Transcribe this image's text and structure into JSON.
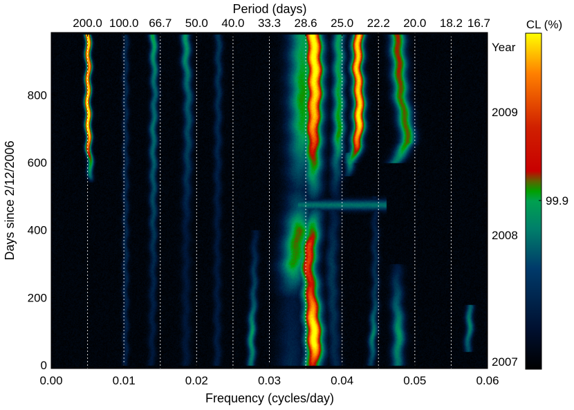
{
  "chart_data": {
    "type": "heatmap",
    "title": "",
    "xlabel": "Frequency (cycles/day)",
    "ylabel": "Days since 2/12/2006",
    "top_axis_label": "Period (days)",
    "right_axis_label": "Year",
    "colorbar_label": "CL (%)",
    "colorbar_tick": "99.9",
    "xlim": [
      0.0,
      0.06
    ],
    "ylim": [
      -10,
      985
    ],
    "x_ticks": [
      {
        "value": 0.0,
        "label": "0.00"
      },
      {
        "value": 0.01,
        "label": "0.01"
      },
      {
        "value": 0.02,
        "label": "0.02"
      },
      {
        "value": 0.03,
        "label": "0.03"
      },
      {
        "value": 0.04,
        "label": "0.04"
      },
      {
        "value": 0.05,
        "label": "0.05"
      },
      {
        "value": 0.06,
        "label": "0.06"
      }
    ],
    "y_ticks": [
      {
        "value": 0,
        "label": "0"
      },
      {
        "value": 200,
        "label": "200"
      },
      {
        "value": 400,
        "label": "400"
      },
      {
        "value": 600,
        "label": "600"
      },
      {
        "value": 800,
        "label": "800"
      }
    ],
    "period_ticks": [
      {
        "freq": 0.005,
        "label": "200.0"
      },
      {
        "freq": 0.01,
        "label": "100.0"
      },
      {
        "freq": 0.015,
        "label": "66.7"
      },
      {
        "freq": 0.02,
        "label": "50.0"
      },
      {
        "freq": 0.025,
        "label": "40.0"
      },
      {
        "freq": 0.03,
        "label": "33.3"
      },
      {
        "freq": 0.035,
        "label": "28.6"
      },
      {
        "freq": 0.04,
        "label": "25.0"
      },
      {
        "freq": 0.045,
        "label": "22.2"
      },
      {
        "freq": 0.05,
        "label": "20.0"
      },
      {
        "freq": 0.055,
        "label": "18.2"
      },
      {
        "freq": 0.06,
        "label": "16.7"
      }
    ],
    "year_ticks": [
      {
        "day": 10,
        "label": "2007"
      },
      {
        "day": 385,
        "label": "2008"
      },
      {
        "day": 750,
        "label": "2009"
      }
    ],
    "grid": "vertical dashed white lines at period tick frequencies",
    "colormap": [
      "#000000",
      "#001a40",
      "#005a6a",
      "#00a060",
      "#00a000",
      "#c80000",
      "#ff8000",
      "#ffff00"
    ],
    "background_color": "#000000",
    "ridges": [
      {
        "name": "",
        "points": [
          [
            0,
            0.0055,
            0.0002
          ],
          [
            200,
            0.0056,
            0.0002
          ],
          [
            400,
            0.0055,
            0.0002
          ],
          [
            540,
            0.0054,
            0.0003
          ],
          [
            560,
            0.0054,
            0.35
          ],
          [
            600,
            0.0053,
            0.55
          ],
          [
            650,
            0.0051,
            0.85
          ],
          [
            700,
            0.0051,
            1.0
          ],
          [
            760,
            0.005,
            1.0
          ],
          [
            820,
            0.005,
            0.95
          ],
          [
            880,
            0.0051,
            0.9
          ],
          [
            980,
            0.005,
            1.0
          ]
        ],
        "width": 0.0004
      },
      {
        "name": "",
        "points": [
          [
            0,
            0.036,
            0.7
          ],
          [
            60,
            0.0362,
            1.0
          ],
          [
            120,
            0.036,
            1.0
          ],
          [
            180,
            0.0358,
            0.85
          ],
          [
            240,
            0.0356,
            0.7
          ],
          [
            300,
            0.0352,
            0.75
          ],
          [
            360,
            0.0356,
            0.75
          ],
          [
            420,
            0.036,
            0.5
          ],
          [
            480,
            0.0362,
            0.1
          ],
          [
            520,
            0.036,
            0.3
          ],
          [
            600,
            0.036,
            0.6
          ],
          [
            650,
            0.036,
            0.75
          ],
          [
            720,
            0.036,
            0.9
          ],
          [
            800,
            0.0362,
            0.95
          ],
          [
            880,
            0.0362,
            1.0
          ],
          [
            980,
            0.036,
            1.0
          ]
        ],
        "width": 0.0012
      },
      {
        "name": "",
        "points": [
          [
            0,
            0.033,
            0.15
          ],
          [
            200,
            0.033,
            0.1
          ],
          [
            300,
            0.0333,
            0.55
          ],
          [
            400,
            0.034,
            0.6
          ],
          [
            460,
            0.034,
            0.3
          ],
          [
            520,
            0.034,
            0.15
          ],
          [
            700,
            0.0345,
            0.5
          ],
          [
            800,
            0.0345,
            0.55
          ],
          [
            980,
            0.0345,
            0.45
          ]
        ],
        "width": 0.0018
      },
      {
        "name": "",
        "points": [
          [
            0,
            0.039,
            0.15
          ],
          [
            300,
            0.0385,
            0.2
          ],
          [
            500,
            0.039,
            0.1
          ],
          [
            600,
            0.0392,
            0.3
          ],
          [
            680,
            0.0395,
            0.55
          ],
          [
            800,
            0.0395,
            0.5
          ],
          [
            980,
            0.0395,
            0.45
          ]
        ],
        "width": 0.0008
      },
      {
        "name": "",
        "points": [
          [
            600,
            0.0412,
            0.4
          ],
          [
            650,
            0.042,
            0.8
          ],
          [
            720,
            0.0423,
            1.0
          ],
          [
            800,
            0.0423,
            0.95
          ],
          [
            880,
            0.042,
            0.95
          ],
          [
            980,
            0.0422,
            0.95
          ]
        ],
        "width": 0.0008
      },
      {
        "name": "",
        "points": [
          [
            560,
            0.0408,
            0.15
          ],
          [
            600,
            0.041,
            0.45
          ],
          [
            630,
            0.041,
            0.3
          ]
        ],
        "width": 0.0006
      },
      {
        "name": "",
        "points": [
          [
            600,
            0.0472,
            0.35
          ],
          [
            660,
            0.049,
            0.6
          ],
          [
            720,
            0.0487,
            0.6
          ],
          [
            800,
            0.048,
            0.6
          ],
          [
            880,
            0.0478,
            0.65
          ],
          [
            980,
            0.0475,
            0.65
          ]
        ],
        "width": 0.001
      },
      {
        "name": "",
        "points": [
          [
            0,
            0.0475,
            0.35
          ],
          [
            100,
            0.0478,
            0.45
          ],
          [
            180,
            0.0475,
            0.3
          ],
          [
            300,
            0.0475,
            0.1
          ]
        ],
        "width": 0.0008
      },
      {
        "name": "",
        "points": [
          [
            0,
            0.0138,
            0.1
          ],
          [
            300,
            0.014,
            0.15
          ],
          [
            600,
            0.014,
            0.3
          ],
          [
            700,
            0.014,
            0.35
          ],
          [
            800,
            0.0142,
            0.3
          ],
          [
            980,
            0.014,
            0.5
          ]
        ],
        "width": 0.0005
      },
      {
        "name": "",
        "points": [
          [
            0,
            0.0185,
            0.1
          ],
          [
            400,
            0.0185,
            0.1
          ],
          [
            700,
            0.0188,
            0.25
          ],
          [
            800,
            0.0188,
            0.3
          ],
          [
            900,
            0.0185,
            0.4
          ],
          [
            980,
            0.0185,
            0.45
          ]
        ],
        "width": 0.0006
      },
      {
        "name": "",
        "points": [
          [
            0,
            0.0275,
            0.35
          ],
          [
            100,
            0.0275,
            0.45
          ],
          [
            200,
            0.0278,
            0.25
          ],
          [
            400,
            0.028,
            0.1
          ]
        ],
        "width": 0.0005
      },
      {
        "name": "",
        "points": [
          [
            0,
            0.044,
            0.2
          ],
          [
            90,
            0.0442,
            0.4
          ],
          [
            200,
            0.0445,
            0.2
          ],
          [
            500,
            0.0445,
            0.1
          ]
        ],
        "width": 0.0005
      },
      {
        "name": "",
        "points": [
          [
            40,
            0.0572,
            0.25
          ],
          [
            120,
            0.0575,
            0.4
          ],
          [
            180,
            0.0575,
            0.3
          ]
        ],
        "width": 0.0005
      },
      {
        "name": "",
        "points": [
          [
            0,
            0.0102,
            0.12
          ],
          [
            300,
            0.0102,
            0.15
          ],
          [
            980,
            0.0102,
            0.15
          ]
        ],
        "width": 0.0004
      },
      {
        "name": "",
        "points": [
          [
            0,
            0.0228,
            0.12
          ],
          [
            400,
            0.0228,
            0.1
          ],
          [
            980,
            0.023,
            0.2
          ]
        ],
        "width": 0.0005
      }
    ],
    "horizontal_bands": [
      {
        "day": 475,
        "fmin": 0.034,
        "fmax": 0.046,
        "intensity": 0.35,
        "height": 15
      }
    ]
  }
}
